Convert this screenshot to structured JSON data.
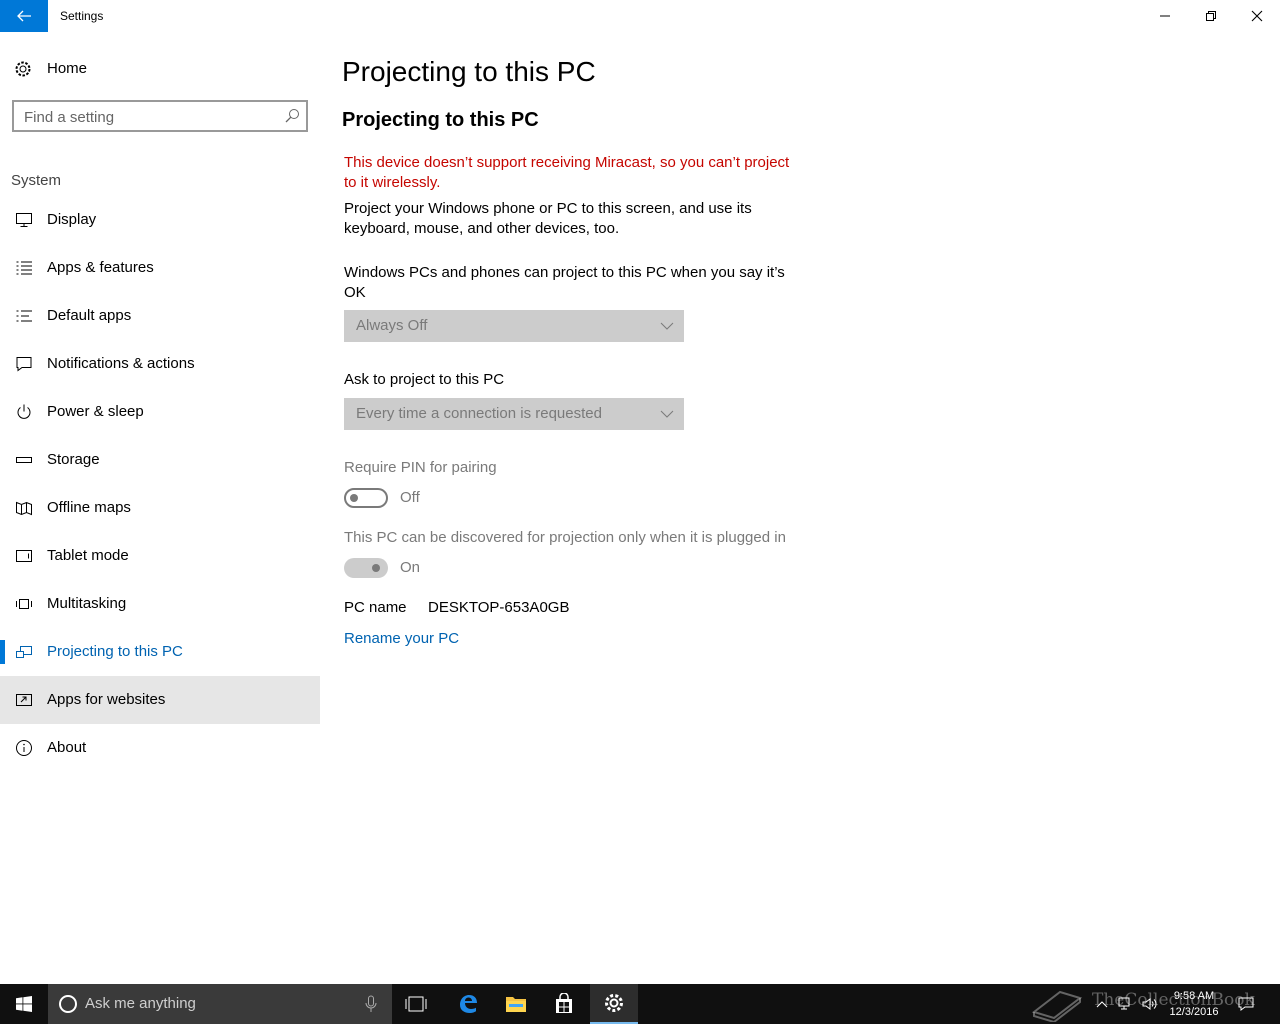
{
  "window": {
    "title": "Settings"
  },
  "sidebar": {
    "home_label": "Home",
    "search_placeholder": "Find a setting",
    "section_label": "System",
    "items": [
      {
        "label": "Display",
        "icon": "monitor-icon"
      },
      {
        "label": "Apps & features",
        "icon": "list-icon"
      },
      {
        "label": "Default apps",
        "icon": "default-apps-icon"
      },
      {
        "label": "Notifications & actions",
        "icon": "notification-icon"
      },
      {
        "label": "Power & sleep",
        "icon": "power-icon"
      },
      {
        "label": "Storage",
        "icon": "storage-icon"
      },
      {
        "label": "Offline maps",
        "icon": "map-icon"
      },
      {
        "label": "Tablet mode",
        "icon": "tablet-icon"
      },
      {
        "label": "Multitasking",
        "icon": "multitasking-icon"
      },
      {
        "label": "Projecting to this PC",
        "icon": "projecting-icon",
        "active": true
      },
      {
        "label": "Apps for websites",
        "icon": "apps-websites-icon",
        "hover": true
      },
      {
        "label": "About",
        "icon": "info-icon"
      }
    ]
  },
  "main": {
    "page_title": "Projecting to this PC",
    "section_title": "Projecting to this PC",
    "error_text": "This device doesn’t support receiving Miracast, so you can’t project to it wirelessly.",
    "description": "Project your Windows phone or PC to this screen, and use its keyboard, mouse, and other devices, too.",
    "permission_label": "Windows PCs and phones can project to this PC when you say it’s OK",
    "permission_value": "Always Off",
    "ask_label": "Ask to project to this PC",
    "ask_value": "Every time a connection is requested",
    "pin_label": "Require PIN for pairing",
    "pin_state": "Off",
    "plugged_label": "This PC can be discovered for projection only when it is plugged in",
    "plugged_state": "On",
    "pc_name_label": "PC name",
    "pc_name_value": "DESKTOP-653A0GB",
    "rename_link": "Rename your PC"
  },
  "taskbar": {
    "search_placeholder": "Ask me anything",
    "time": "9:58 AM",
    "date": "12/3/2016",
    "watermark": "TheCollectionBook"
  },
  "colors": {
    "accent": "#0078d7",
    "link": "#0063b1",
    "error": "#c50500",
    "disabled": "#7a7a7a",
    "taskbar": "#101010"
  }
}
